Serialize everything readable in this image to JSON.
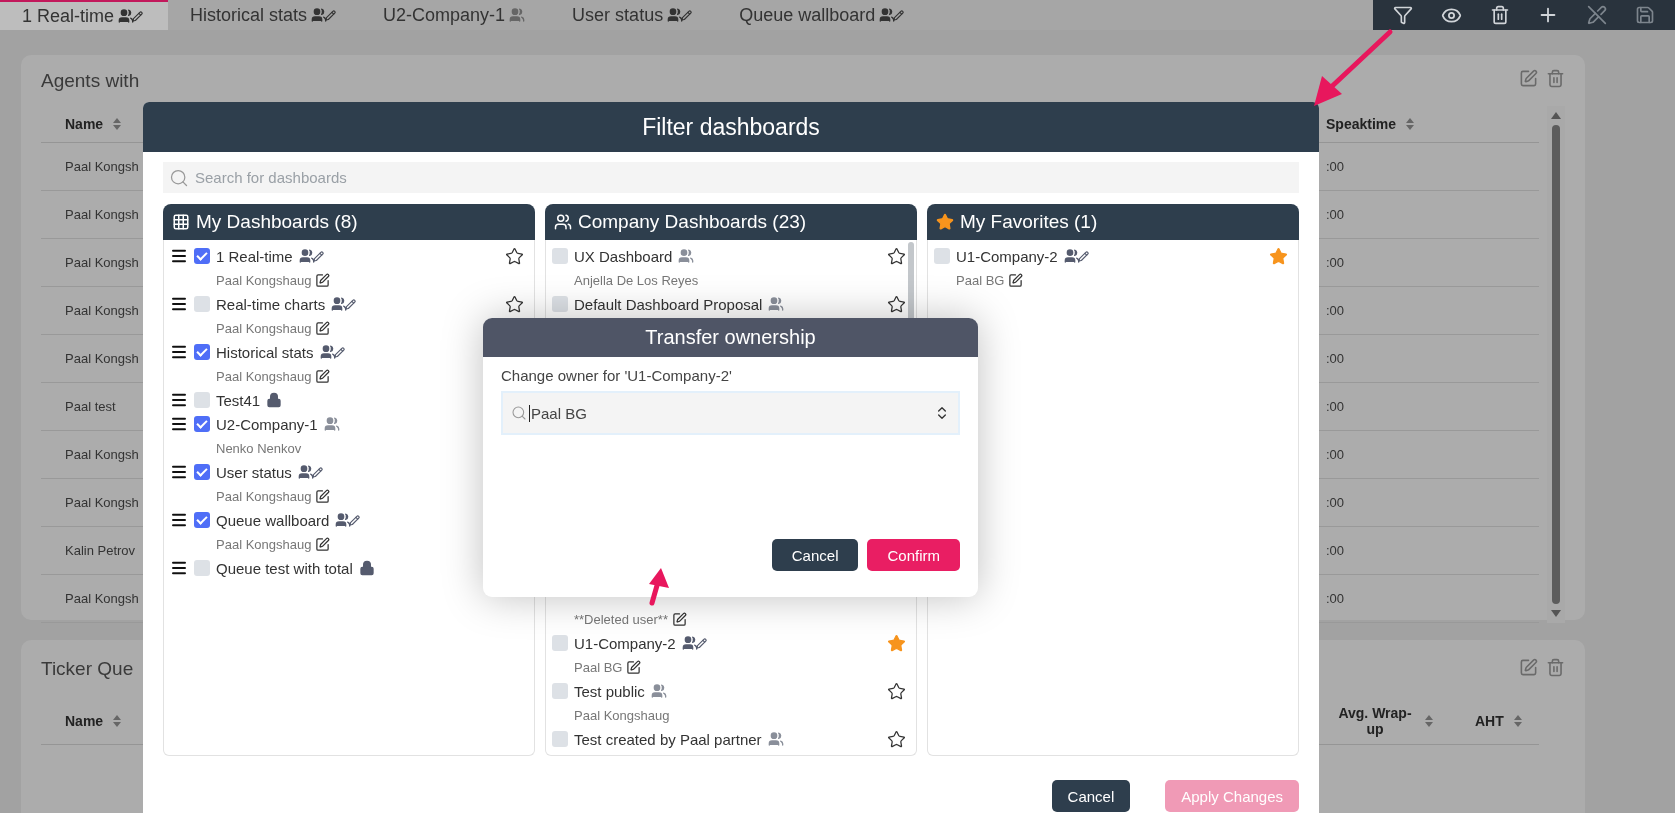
{
  "tabs": [
    {
      "label": "1 Real-time",
      "kind": "shared-edit",
      "selected": true
    },
    {
      "label": "Historical stats",
      "kind": "shared-edit",
      "selected": false
    },
    {
      "label": "U2-Company-1",
      "kind": "shared",
      "selected": false
    },
    {
      "label": "User status",
      "kind": "shared-edit",
      "selected": false
    },
    {
      "label": "Queue wallboard",
      "kind": "shared-edit",
      "selected": false
    }
  ],
  "background_cards": [
    {
      "title": "Agents with",
      "columns": [
        "Name",
        "Speaktime"
      ],
      "rows": [
        [
          "Paal Kongsh",
          ":00"
        ],
        [
          "Paal Kongsh",
          ":00"
        ],
        [
          "Paal Kongsh",
          ":00"
        ],
        [
          "Paal Kongsh",
          ":00"
        ],
        [
          "Paal Kongsh",
          ":00"
        ],
        [
          "Paal test",
          ":00"
        ],
        [
          "Paal Kongsh",
          ":00"
        ],
        [
          "Paal Kongsh",
          ":00"
        ],
        [
          "Kalin Petrov",
          ":00"
        ],
        [
          "Paal Kongsh",
          ":00"
        ]
      ]
    },
    {
      "title": "Ticker Que",
      "columns": [
        "Name",
        "Avg. Wrap-up",
        "AHT"
      ]
    }
  ],
  "filter_dialog": {
    "title": "Filter dashboards",
    "search": {
      "placeholder": "Search for dashboards"
    },
    "columns": [
      {
        "title": "My Dashboards (8)",
        "items": [
          {
            "name": "1 Real-time",
            "checked": true,
            "kind": "shared-edit",
            "favorite": false,
            "owner": "Paal Kongshaug",
            "owner_editable": true
          },
          {
            "name": "Real-time charts",
            "checked": false,
            "kind": "shared-edit",
            "favorite": false,
            "owner": "Paal Kongshaug",
            "owner_editable": true
          },
          {
            "name": "Historical stats",
            "checked": true,
            "kind": "shared-edit",
            "owner": "Paal Kongshaug",
            "owner_editable": true
          },
          {
            "name": "Test41",
            "checked": false,
            "kind": "private"
          },
          {
            "name": "U2-Company-1",
            "checked": true,
            "kind": "shared",
            "owner": "Nenko Nenkov",
            "owner_editable": false
          },
          {
            "name": "User status",
            "checked": true,
            "kind": "shared-edit",
            "owner": "Paal Kongshaug",
            "owner_editable": true
          },
          {
            "name": "Queue wallboard",
            "checked": true,
            "kind": "shared-edit",
            "owner": "Paal Kongshaug",
            "owner_editable": true
          },
          {
            "name": "Queue test with total",
            "checked": false,
            "kind": "private"
          }
        ]
      },
      {
        "title": "Company Dashboards (23)",
        "items": [
          {
            "name": "UX Dashboard",
            "checked": false,
            "kind": "shared",
            "favorite": false,
            "owner": "Anjella De Los Reyes",
            "owner_editable": false
          },
          {
            "name": "Default Dashboard Proposal",
            "checked": false,
            "kind": "shared",
            "favorite": false
          }
        ],
        "more_items": [
          {
            "owner": "**Deleted user**",
            "owner_editable": true
          },
          {
            "name": "U1-Company-2",
            "checked": false,
            "kind": "shared-edit",
            "favorite": true,
            "owner": "Paal BG",
            "owner_editable": true
          },
          {
            "name": "Test public",
            "checked": false,
            "kind": "shared",
            "favorite": false,
            "owner": "Paal Kongshaug",
            "owner_editable": false
          },
          {
            "name": "Test created by Paal partner",
            "checked": false,
            "kind": "shared",
            "favorite": false
          }
        ]
      },
      {
        "title": "My Favorites (1)",
        "items": [
          {
            "name": "U1-Company-2",
            "checked": false,
            "kind": "shared-edit",
            "favorite": true,
            "owner": "Paal BG",
            "owner_editable": true
          }
        ]
      }
    ],
    "buttons": [
      {
        "label": "Cancel",
        "kind": "secondary",
        "disabled": false
      },
      {
        "label": "Apply Changes",
        "kind": "primary",
        "disabled": true
      }
    ]
  },
  "transfer_dialog": {
    "title": "Transfer ownership",
    "label": "Change owner for 'U1-Company-2'",
    "select": {
      "value": "Paal BG"
    },
    "buttons": [
      {
        "label": "Cancel",
        "kind": "secondary",
        "disabled": false
      },
      {
        "label": "Confirm",
        "kind": "primary",
        "disabled": false
      }
    ]
  }
}
